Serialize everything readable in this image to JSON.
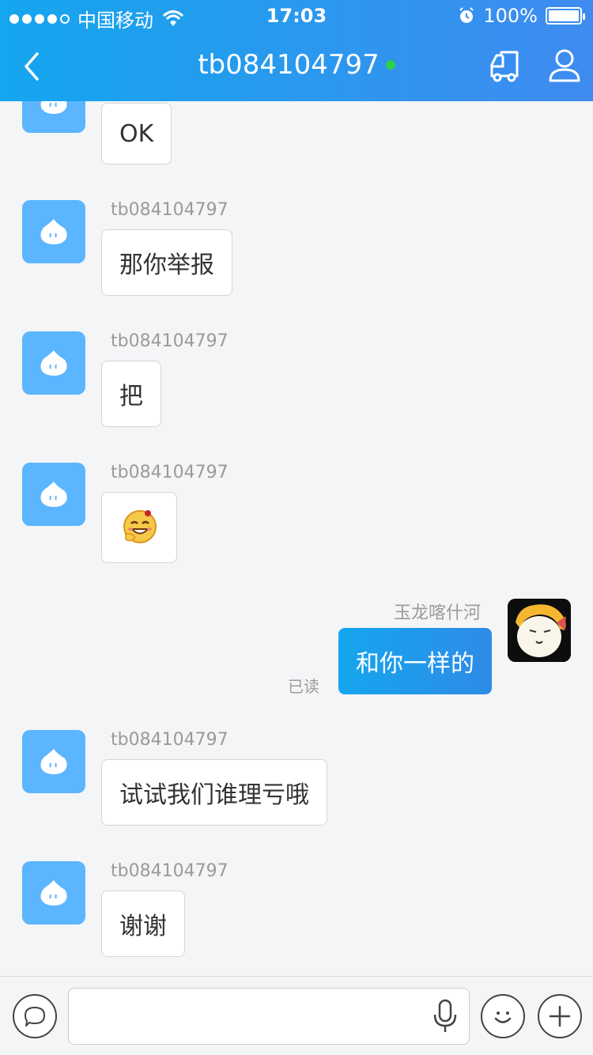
{
  "status_bar": {
    "carrier": "中国移动",
    "time": "17:03",
    "battery": "100%"
  },
  "header": {
    "title": "tb084104797",
    "online_color": "#2bd14a"
  },
  "messages": [
    {
      "side": "left",
      "sender": "",
      "text": "OK"
    },
    {
      "side": "left",
      "sender": "tb084104797",
      "text": "那你举报"
    },
    {
      "side": "left",
      "sender": "tb084104797",
      "text": "把"
    },
    {
      "side": "left",
      "sender": "tb084104797",
      "text": "",
      "emoji": "laughing-emoji"
    },
    {
      "side": "right",
      "sender": "玉龙喀什河",
      "text": "和你一样的",
      "status": "已读"
    },
    {
      "side": "left",
      "sender": "tb084104797",
      "text": "试试我们谁理亏哦"
    },
    {
      "side": "left",
      "sender": "tb084104797",
      "text": "谢谢"
    }
  ],
  "input": {
    "placeholder": "",
    "value": ""
  },
  "icons": {
    "back": "chevron-left-icon",
    "truck": "truck-icon",
    "profile": "user-icon",
    "chat": "chat-bubble-icon",
    "mic": "microphone-icon",
    "emoji": "smile-icon",
    "plus": "plus-icon"
  }
}
